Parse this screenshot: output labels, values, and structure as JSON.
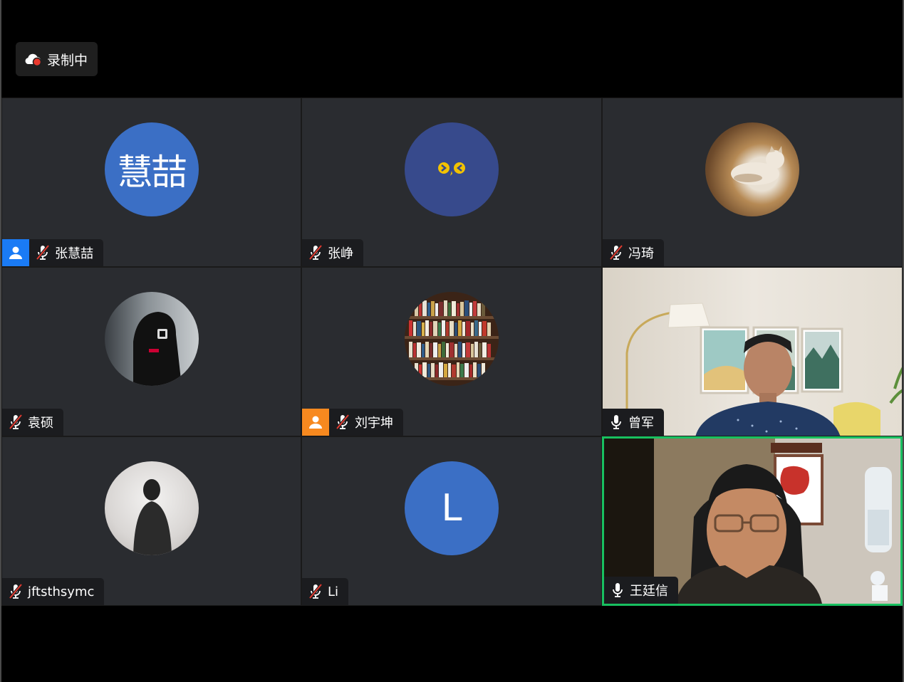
{
  "recording": {
    "label": "录制中",
    "icon": "cloud-record-icon"
  },
  "colors": {
    "tile_bg": "#2a2c30",
    "name_bg": "#1b1c1f",
    "host_blue": "#1a7bf5",
    "cohost_orange": "#f7891f",
    "speaking_border": "#18c060",
    "avatar_blue": "#3b6fc5",
    "avatar_navy": "#374a8c"
  },
  "participants": [
    {
      "name": "张慧喆",
      "avatar_text": "慧喆",
      "mic": "muted",
      "badge": "host"
    },
    {
      "name": "张峥",
      "avatar_text": "",
      "mic": "muted",
      "badge": ""
    },
    {
      "name": "冯琦",
      "avatar_text": "",
      "mic": "muted",
      "badge": ""
    },
    {
      "name": "袁硕",
      "avatar_text": "",
      "mic": "muted",
      "badge": ""
    },
    {
      "name": "刘宇坤",
      "avatar_text": "",
      "mic": "muted",
      "badge": "cohost"
    },
    {
      "name": "曾军",
      "avatar_text": "",
      "mic": "on",
      "badge": ""
    },
    {
      "name": "jftsthsymc",
      "avatar_text": "",
      "mic": "muted",
      "badge": ""
    },
    {
      "name": "Li",
      "avatar_text": "L",
      "mic": "muted",
      "badge": ""
    },
    {
      "name": "王廷信",
      "avatar_text": "",
      "mic": "on",
      "badge": "",
      "speaking": true
    }
  ]
}
